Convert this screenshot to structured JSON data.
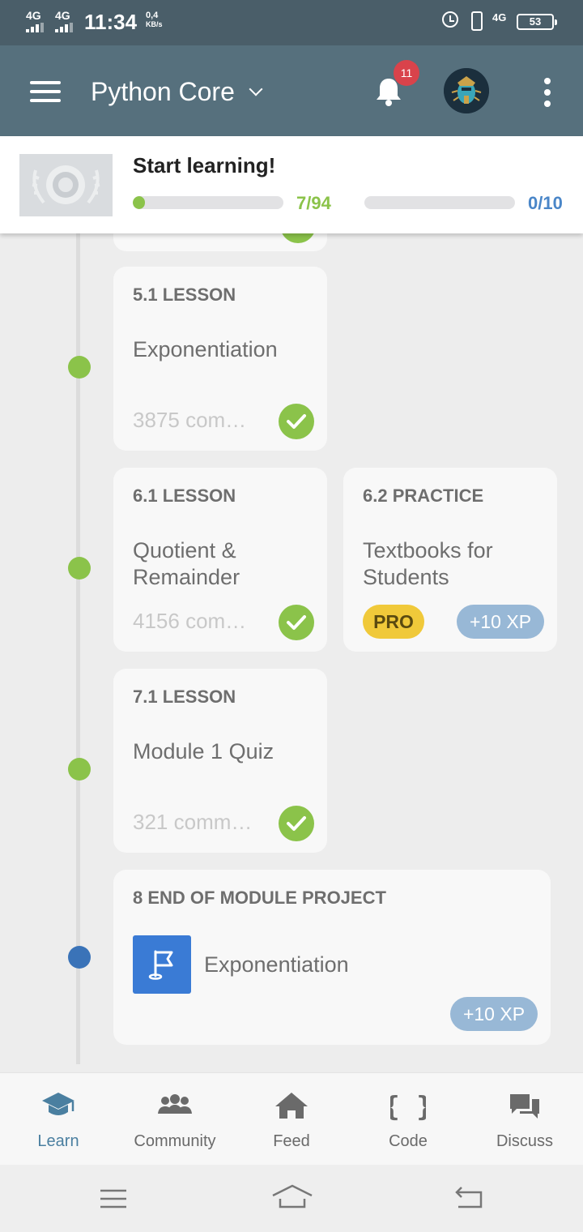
{
  "status_bar": {
    "sim1": "4G",
    "sim2": "4G",
    "time": "11:34",
    "speed_value": "0,4",
    "speed_unit": "KB/s",
    "net": "4G",
    "battery": "53"
  },
  "app_bar": {
    "course_title": "Python Core",
    "notification_count": "11"
  },
  "progress_header": {
    "title": "Start learning!",
    "lessons_progress": "7/94",
    "lessons_fraction": 0.074,
    "projects_progress": "0/10",
    "projects_fraction": 0.0
  },
  "lessons": [
    {
      "tag": "5.1 LESSON",
      "title": "Exponentiation",
      "comments": "3875 com…"
    },
    {
      "tag": "6.1 LESSON",
      "title": "Quotient & Remainder",
      "comments": "4156 com…"
    },
    {
      "tag": "6.2 PRACTICE",
      "title": "Textbooks for Students",
      "pro": "PRO",
      "xp": "+10 XP"
    },
    {
      "tag": "7.1 LESSON",
      "title": "Module 1 Quiz",
      "comments": "321 comm…"
    },
    {
      "tag": "8 END OF MODULE PROJECT",
      "title": "Exponentiation",
      "xp": "+10 XP"
    }
  ],
  "bottom_nav": {
    "items": [
      {
        "label": "Learn",
        "icon": "graduation-cap-icon",
        "active": true
      },
      {
        "label": "Community",
        "icon": "people-icon"
      },
      {
        "label": "Feed",
        "icon": "home-icon"
      },
      {
        "label": "Code",
        "icon": "braces-icon"
      },
      {
        "label": "Discuss",
        "icon": "chat-bubbles-icon"
      }
    ]
  },
  "colors": {
    "status_bar": "#4a5e69",
    "app_bar": "#56707d",
    "complete_green": "#8bc34a",
    "project_blue": "#3a7bd5",
    "accent_blue": "#4a86c8",
    "pro_yellow": "#f0c93a",
    "xp_pill": "#98b8d6"
  }
}
